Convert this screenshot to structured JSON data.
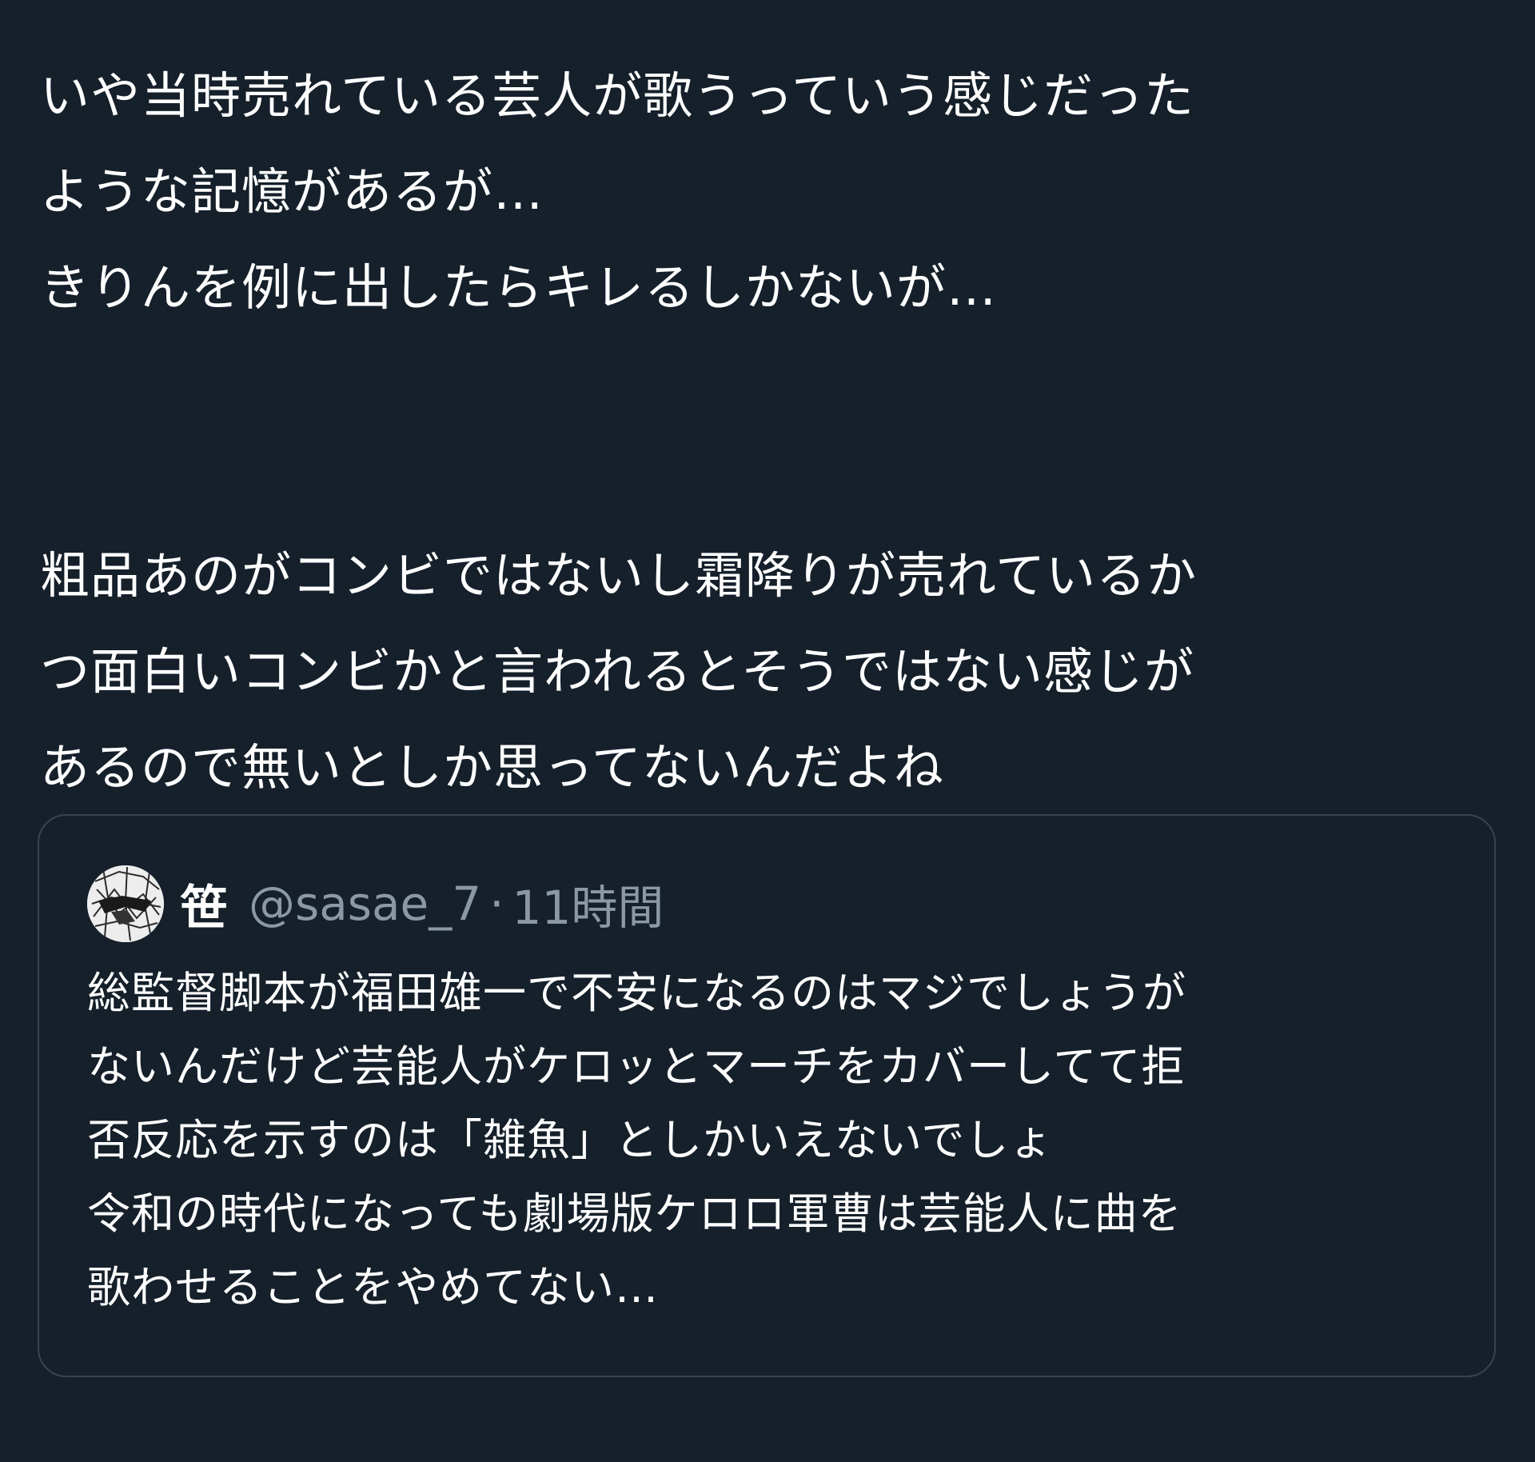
{
  "tweet": {
    "lines": [
      "いや当時売れている芸人が歌うっていう感じだった",
      "ような記憶があるが…",
      "きりんを例に出したらキレるしかないが…",
      "粗品あのがコンビではないし霜降りが売れているか",
      "つ面白いコンビかと言われるとそうではない感じが",
      "あるので無いとしか思ってないんだよね"
    ]
  },
  "quoted_tweet": {
    "display_name": "笹",
    "handle": "@sasae_7",
    "separator": "·",
    "time": "11時間",
    "avatar_icon": "avatar-icon",
    "lines": [
      "総監督脚本が福田雄一で不安になるのはマジでしょうが",
      "ないんだけど芸能人がケロッとマーチをカバーしてて拒",
      "否反応を示すのは「雑魚」としかいえないでしょ",
      "令和の時代になっても劇場版ケロロ軍曹は芸能人に曲を",
      "歌わせることをやめてない…"
    ]
  },
  "colors": {
    "background": "#15202b",
    "text": "#ffffff",
    "secondary_text": "#8b98a5",
    "border": "#38444d"
  }
}
